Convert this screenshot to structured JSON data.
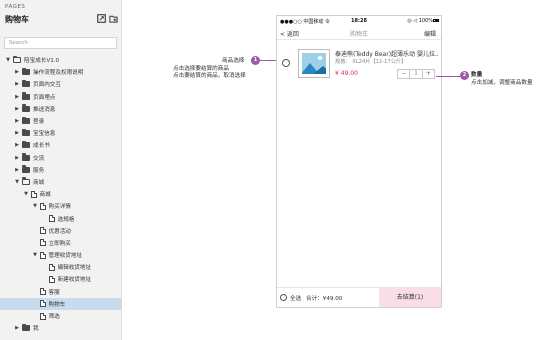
{
  "sidebar": {
    "pages_label": "PAGES",
    "title": "购物车",
    "search_placeholder": "Search",
    "tree": [
      {
        "label": "陪宝成长V1.0",
        "indent": 0,
        "icon": "folder-open",
        "arrow": "down"
      },
      {
        "label": "操作流程及权限说明",
        "indent": 1,
        "icon": "folder",
        "arrow": "right"
      },
      {
        "label": "页面内交互",
        "indent": 1,
        "icon": "folder",
        "arrow": "right"
      },
      {
        "label": "页面埋点",
        "indent": 1,
        "icon": "folder",
        "arrow": "right"
      },
      {
        "label": "推送消息",
        "indent": 1,
        "icon": "folder",
        "arrow": "right"
      },
      {
        "label": "登录",
        "indent": 1,
        "icon": "folder",
        "arrow": "right"
      },
      {
        "label": "宝宝信息",
        "indent": 1,
        "icon": "folder",
        "arrow": "right"
      },
      {
        "label": "成长书",
        "indent": 1,
        "icon": "folder",
        "arrow": "right"
      },
      {
        "label": "交流",
        "indent": 1,
        "icon": "folder",
        "arrow": "right"
      },
      {
        "label": "服务",
        "indent": 1,
        "icon": "folder",
        "arrow": "right"
      },
      {
        "label": "商城",
        "indent": 1,
        "icon": "folder-open",
        "arrow": "down"
      },
      {
        "label": "商城",
        "indent": 2,
        "icon": "file",
        "arrow": "down"
      },
      {
        "label": "购买详情",
        "indent": 3,
        "icon": "file",
        "arrow": "down"
      },
      {
        "label": "选规格",
        "indent": 4,
        "icon": "file",
        "arrow": "none"
      },
      {
        "label": "优惠活动",
        "indent": 3,
        "icon": "file",
        "arrow": "none"
      },
      {
        "label": "立即购买",
        "indent": 3,
        "icon": "file",
        "arrow": "none"
      },
      {
        "label": "管理收货地址",
        "indent": 3,
        "icon": "file",
        "arrow": "down"
      },
      {
        "label": "编辑收货地址",
        "indent": 4,
        "icon": "file",
        "arrow": "none"
      },
      {
        "label": "新建收货地址",
        "indent": 4,
        "icon": "file",
        "arrow": "none"
      },
      {
        "label": "客服",
        "indent": 3,
        "icon": "file",
        "arrow": "none"
      },
      {
        "label": "购物车",
        "indent": 3,
        "icon": "file",
        "arrow": "none",
        "selected": true
      },
      {
        "label": "筛选",
        "indent": 3,
        "icon": "file",
        "arrow": "none"
      },
      {
        "label": "我",
        "indent": 1,
        "icon": "folder",
        "arrow": "right"
      }
    ]
  },
  "phone": {
    "status": {
      "carrier": "●●●○○ 中国移动 令",
      "time": "18:28",
      "battery": "◎ ◁ 100%"
    },
    "nav": {
      "back": "< 返回",
      "title": "购物车",
      "edit": "编辑"
    },
    "item": {
      "name": "泰迪熊(Teddy Bear)超薄乐动 婴儿拉...",
      "spec": "规格： XL24片【12-17公斤】",
      "price": "¥ 49.00",
      "minus": "−",
      "qty": "1",
      "plus": "+"
    },
    "footer": {
      "select_all": "全选",
      "total": "合计：¥49.00",
      "checkout": "去结算(1)"
    }
  },
  "annotations": {
    "select": {
      "number": "1",
      "title": "商品选择",
      "lines": [
        "点击选择要结算的商品",
        "点击要结算的商品，取消选择"
      ]
    },
    "quantity": {
      "number": "2",
      "title": "数量",
      "lines": [
        "点击加减，调整商品数量"
      ]
    }
  },
  "colors": {
    "accent": "#9a5ba6",
    "price": "#e0284f",
    "checkout_bg": "#f9dde7",
    "selected_row": "#c9dcef"
  }
}
